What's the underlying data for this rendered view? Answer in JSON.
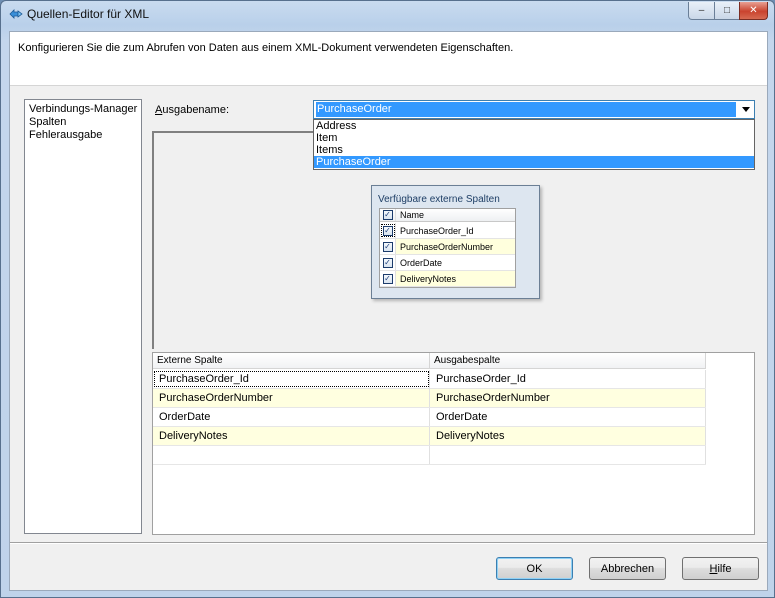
{
  "window": {
    "title": "Quellen-Editor für XML",
    "controls": {
      "minimize": "–",
      "maximize": "□",
      "close": "✕"
    }
  },
  "header": {
    "description": "Konfigurieren Sie die zum Abrufen von Daten aus einem XML-Dokument verwendeten Eigenschaften."
  },
  "nav": {
    "items": [
      {
        "label": "Verbindungs-Manager"
      },
      {
        "label": "Spalten"
      },
      {
        "label": "Fehlerausgabe"
      }
    ]
  },
  "output": {
    "label_prefix": "A",
    "label_rest": "usgabename:",
    "selected": "PurchaseOrder",
    "options": [
      {
        "label": "Address"
      },
      {
        "label": "Item"
      },
      {
        "label": "Items"
      },
      {
        "label": "PurchaseOrder"
      }
    ]
  },
  "external_columns": {
    "title": "Verfügbare externe Spalten",
    "header": "Name",
    "check_mark": "✓",
    "rows": [
      {
        "name": "PurchaseOrder_Id"
      },
      {
        "name": "PurchaseOrderNumber"
      },
      {
        "name": "OrderDate"
      },
      {
        "name": "DeliveryNotes"
      }
    ]
  },
  "mapping": {
    "headers": [
      "Externe Spalte",
      "Ausgabespalte"
    ],
    "rows": [
      [
        "PurchaseOrder_Id",
        "PurchaseOrder_Id"
      ],
      [
        "PurchaseOrderNumber",
        "PurchaseOrderNumber"
      ],
      [
        "OrderDate",
        "OrderDate"
      ],
      [
        "DeliveryNotes",
        "DeliveryNotes"
      ]
    ]
  },
  "buttons": {
    "ok": "OK",
    "cancel": "Abbrechen",
    "help_prefix": "H",
    "help_rest": "ilfe"
  },
  "colors": {
    "selection": "#3399ff",
    "alt_row": "#ffffe0",
    "title_bar": "#bfd3ea"
  }
}
